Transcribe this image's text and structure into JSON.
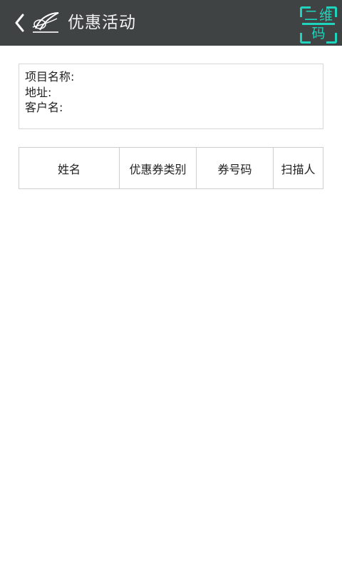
{
  "header": {
    "back_icon": "chevron-left-icon",
    "logo_icon": "brand-logo-icon",
    "title": "优惠活动",
    "scan_button": {
      "line1": "二维",
      "line2": "码",
      "accent_color": "#1fd4bd"
    },
    "background_color": "#404344"
  },
  "info": {
    "project_name_label": "项目名称:",
    "address_label": "地址:",
    "customer_name_label": "客户名:"
  },
  "table": {
    "headers": [
      "姓名",
      "优惠券类别",
      "券号码",
      "扫描人"
    ]
  }
}
